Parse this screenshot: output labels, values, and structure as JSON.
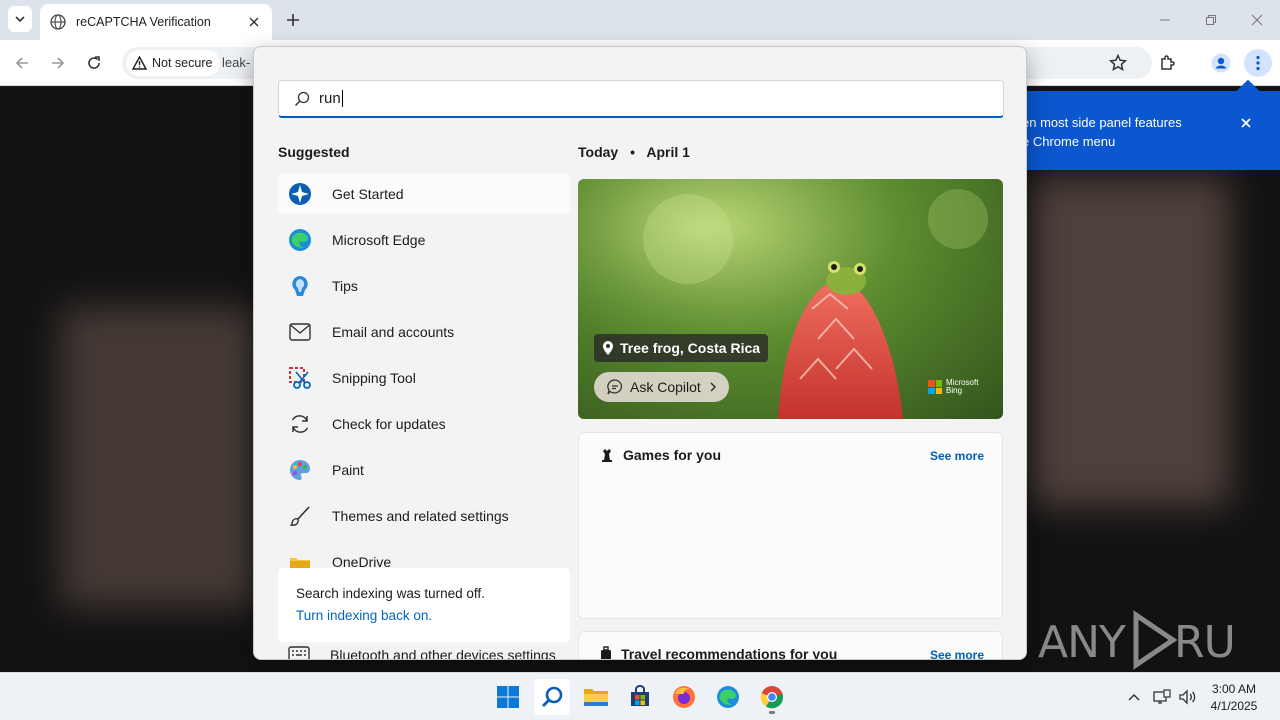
{
  "browser": {
    "tab_title": "reCAPTCHA Verification",
    "security_label": "Not secure",
    "url_text": "leak-",
    "side_panel_tip": {
      "line1": "en most side panel features",
      "line2": "e Chrome menu"
    }
  },
  "watermark": "ANY RUN",
  "search": {
    "query": "run",
    "suggested_label": "Suggested",
    "suggestions": [
      {
        "label": "Get Started",
        "icon": "get-started-icon"
      },
      {
        "label": "Microsoft Edge",
        "icon": "edge-icon"
      },
      {
        "label": "Tips",
        "icon": "tips-icon"
      },
      {
        "label": "Email and accounts",
        "icon": "mail-icon"
      },
      {
        "label": "Snipping Tool",
        "icon": "snipping-tool-icon"
      },
      {
        "label": "Check for updates",
        "icon": "refresh-icon"
      },
      {
        "label": "Paint",
        "icon": "paint-icon"
      },
      {
        "label": "Themes and related settings",
        "icon": "brush-icon"
      },
      {
        "label": "OneDrive",
        "icon": "onedrive-icon"
      }
    ],
    "index_notice": {
      "text": "Search indexing was turned off.",
      "link": "Turn indexing back on."
    },
    "bluetooth_item": "Bluetooth and other devices settings",
    "today_label": "Today",
    "date_label": "April 1",
    "hero": {
      "location": "Tree frog, Costa Rica",
      "copilot": "Ask Copilot",
      "bing_line1": "Microsoft",
      "bing_line2": "Bing"
    },
    "games_card": {
      "title": "Games for you",
      "more": "See more"
    },
    "travel_card": {
      "title": "Travel recommendations for you",
      "more": "See more"
    }
  },
  "taskbar": {
    "apps": [
      "start-icon",
      "search-icon",
      "file-explorer-icon",
      "store-icon",
      "firefox-icon",
      "edge-icon",
      "chrome-icon"
    ],
    "time": "3:00 AM",
    "date": "4/1/2025"
  },
  "colors": {
    "accent": "#005fb8",
    "chrome_blue": "#0b57d0",
    "tabstrip": "#dde3ea"
  }
}
